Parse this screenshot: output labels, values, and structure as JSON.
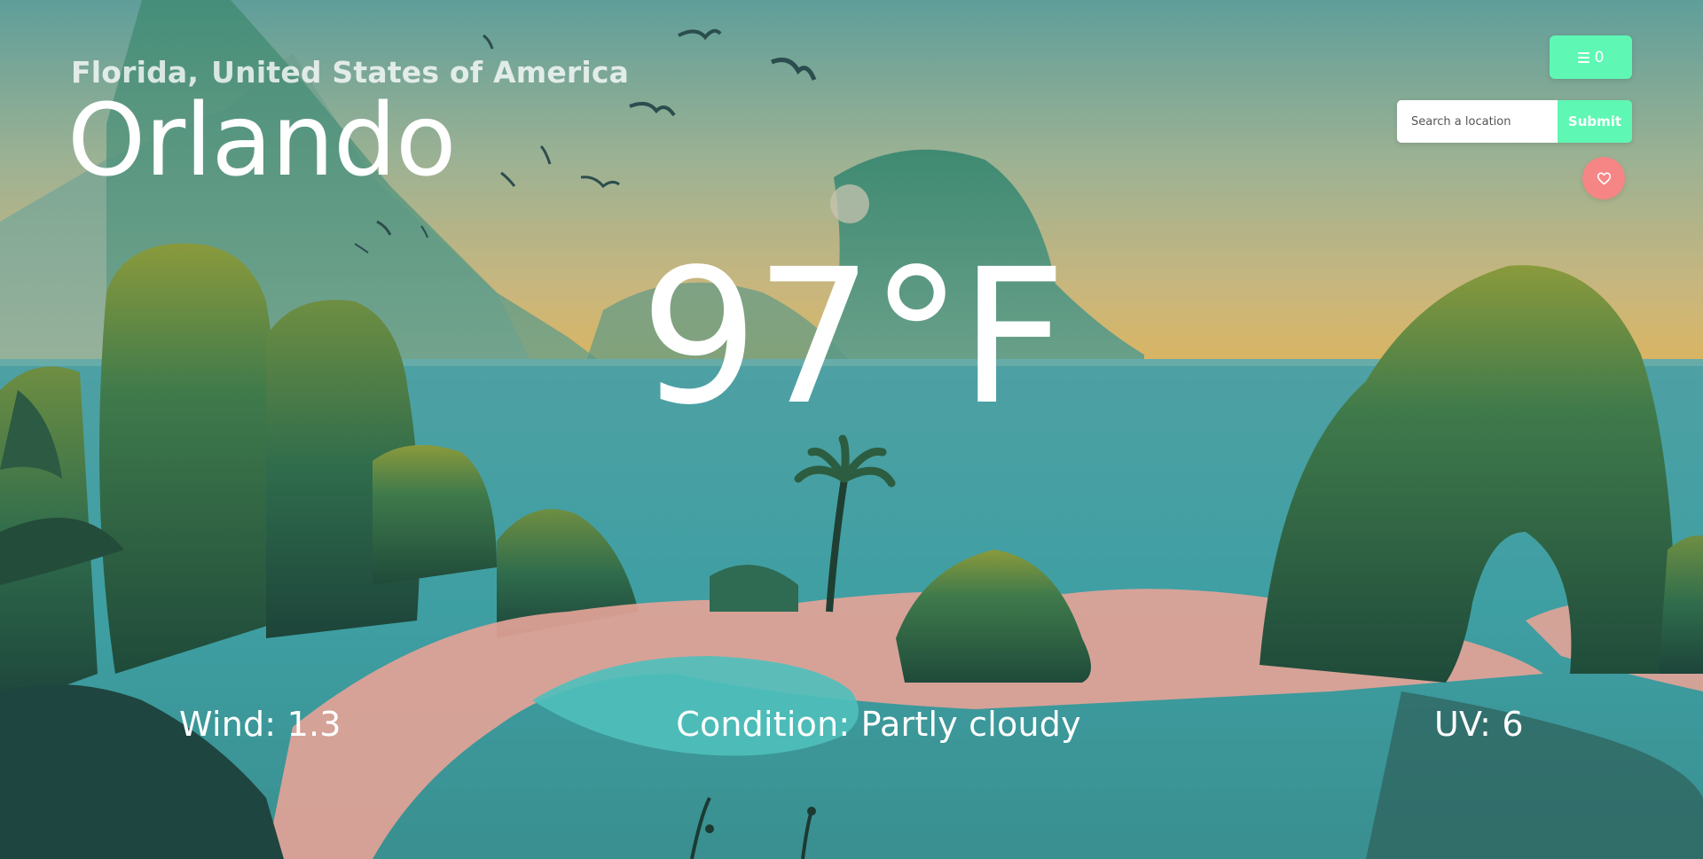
{
  "location": {
    "region": "Florida,",
    "country": "United States of America",
    "city": "Orlando"
  },
  "weather": {
    "temperature": "97°F",
    "wind": "Wind: 1.3",
    "condition": "Condition: Partly cloudy",
    "uv": "UV: 6"
  },
  "toolbar": {
    "menu_count": "0",
    "search_placeholder": "Search a location",
    "submit_label": "Submit",
    "favorite_icon": "heart-icon",
    "menu_icon": "list-icon"
  },
  "colors": {
    "accent": "#5ff7b4",
    "favorite": "#f68585",
    "text": "#ffffff"
  }
}
